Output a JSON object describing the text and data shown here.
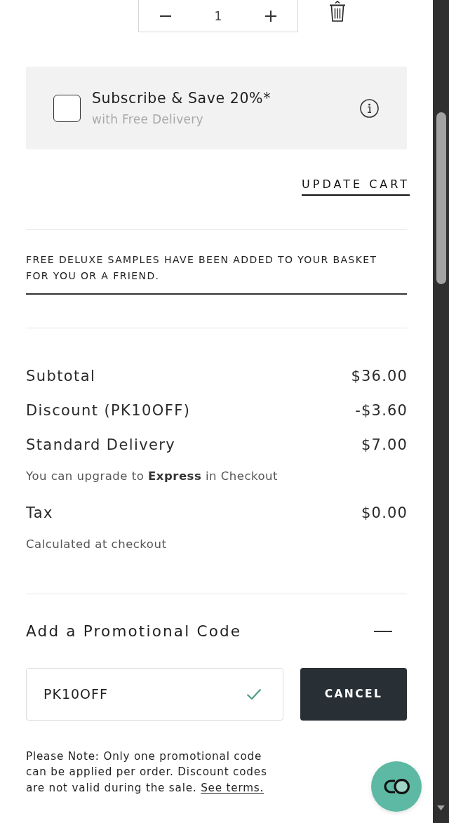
{
  "quantity_stepper": {
    "value": "1"
  },
  "subscribe": {
    "checked": false,
    "title": "Subscribe & Save 20%*",
    "subtitle": "with Free Delivery"
  },
  "update_cart": {
    "label": "UPDATE CART"
  },
  "samples_notice": "FREE DELUXE SAMPLES HAVE BEEN ADDED TO YOUR BASKET FOR YOU OR A FRIEND.",
  "summary": [
    {
      "label": "Subtotal",
      "value": "$36.00"
    },
    {
      "label": "Discount (PK10OFF)",
      "value": "-$3.60"
    },
    {
      "label": "Standard Delivery",
      "value": "$7.00",
      "note": "You can upgrade to **Express** in Checkout"
    },
    {
      "label": "Tax",
      "value": "$0.00",
      "note": "Calculated at checkout"
    }
  ],
  "promo": {
    "title": "Add a Promotional Code",
    "expanded": true,
    "value": "PK10OFF",
    "valid": true,
    "button": "CANCEL",
    "note": "Please Note: Only one promotional code can be applied per order. Discount codes are not valid during the sale.",
    "link": "See terms."
  }
}
